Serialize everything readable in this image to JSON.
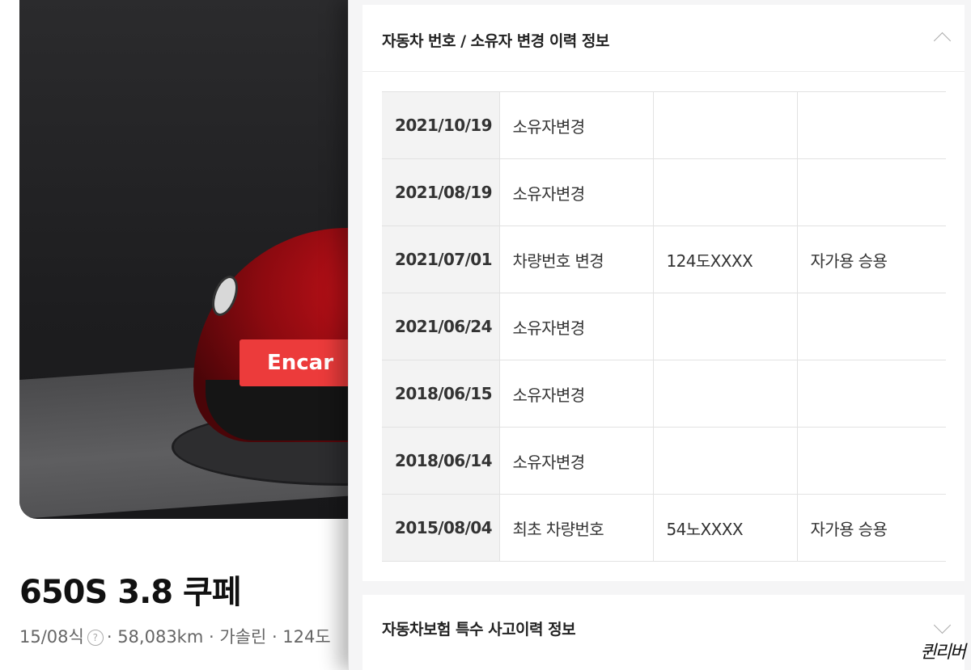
{
  "listing": {
    "photo_plate_text": "Encar",
    "title": "650S 3.8 쿠페",
    "meta_year": "15/08식",
    "meta_rest": "· 58,083km · 가솔린 · 124도"
  },
  "panel": {
    "history_section": {
      "title": "자동차 번호 / 소유자 변경 이력 정보",
      "rows": [
        {
          "date": "2021/10/19",
          "type": "소유자변경",
          "number": "",
          "usage": ""
        },
        {
          "date": "2021/08/19",
          "type": "소유자변경",
          "number": "",
          "usage": ""
        },
        {
          "date": "2021/07/01",
          "type": "차량번호 변경",
          "number": "124도XXXX",
          "usage": "자가용  승용"
        },
        {
          "date": "2021/06/24",
          "type": "소유자변경",
          "number": "",
          "usage": ""
        },
        {
          "date": "2018/06/15",
          "type": "소유자변경",
          "number": "",
          "usage": ""
        },
        {
          "date": "2018/06/14",
          "type": "소유자변경",
          "number": "",
          "usage": ""
        },
        {
          "date": "2015/08/04",
          "type": "최초 차량번호",
          "number": "54노XXXX",
          "usage": "자가용  승용"
        }
      ]
    },
    "accident_section": {
      "title": "자동차보험 특수 사고이력 정보"
    }
  },
  "watermark": "퀸리버"
}
